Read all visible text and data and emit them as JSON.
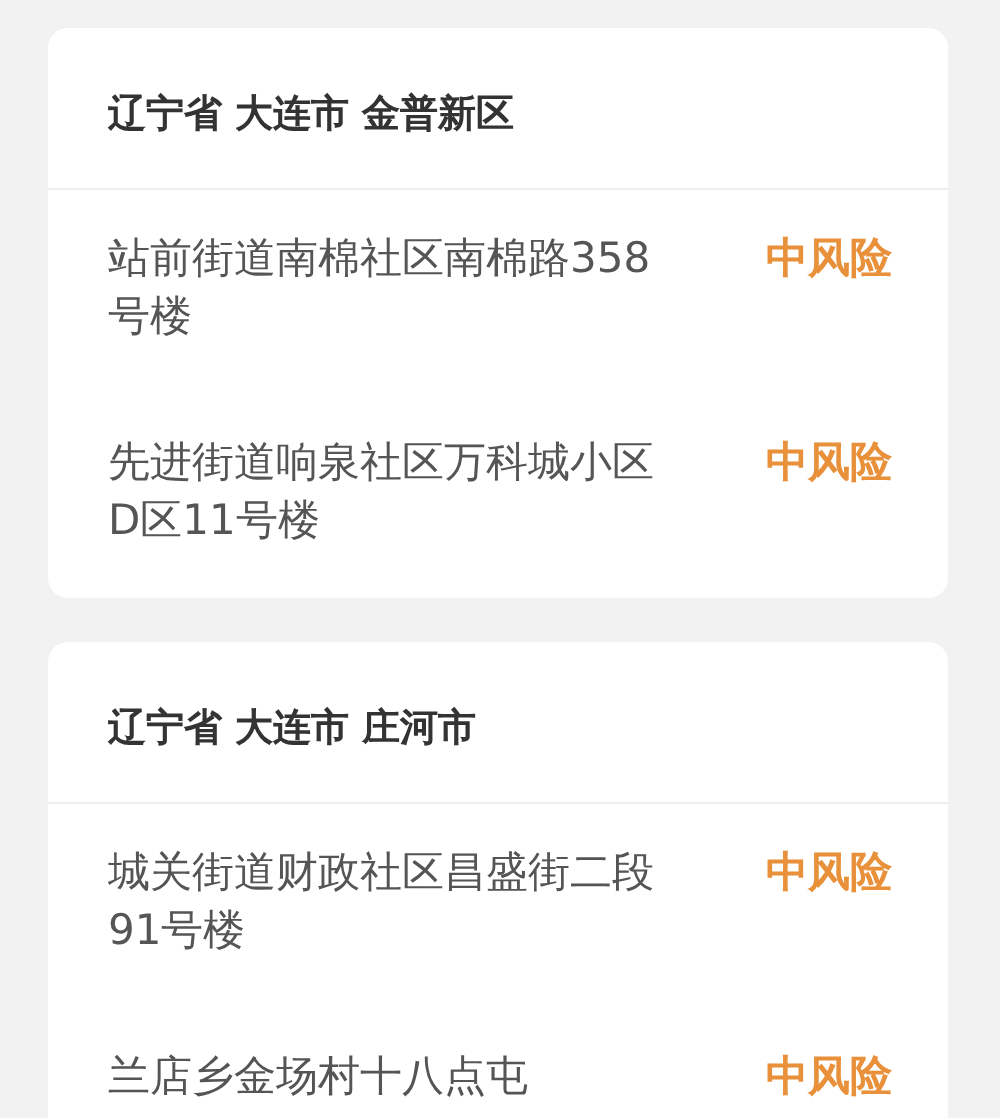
{
  "regions": [
    {
      "title": "辽宁省 大连市 金普新区",
      "places": [
        {
          "address": "站前街道南棉社区南棉路358号楼",
          "risk": "中风险"
        },
        {
          "address": "先进街道响泉社区万科城小区D区11号楼",
          "risk": "中风险"
        }
      ]
    },
    {
      "title": "辽宁省 大连市 庄河市",
      "places": [
        {
          "address": "城关街道财政社区昌盛街二段91号楼",
          "risk": "中风险"
        },
        {
          "address": "兰店乡金场村十八点屯",
          "risk": "中风险"
        }
      ]
    }
  ]
}
